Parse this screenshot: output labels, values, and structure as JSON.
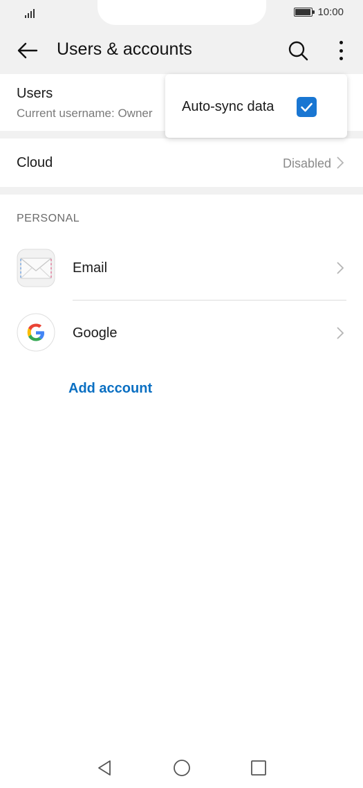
{
  "status_bar": {
    "time": "10:00"
  },
  "app_bar": {
    "title": "Users & accounts",
    "back_icon": "arrow-back-icon",
    "search_icon": "search-icon",
    "more_icon": "more-vert-icon"
  },
  "users": {
    "label": "Users",
    "subtitle": "Current username: Owner"
  },
  "cloud": {
    "label": "Cloud",
    "value": "Disabled"
  },
  "section": {
    "header": "PERSONAL"
  },
  "accounts": [
    {
      "name": "Email",
      "icon": "email-envelope-icon"
    },
    {
      "name": "Google",
      "icon": "google-g-icon"
    }
  ],
  "add_account_label": "Add account",
  "popup": {
    "auto_sync_label": "Auto-sync data",
    "auto_sync_checked": true
  },
  "colors": {
    "accent": "#1976d2",
    "link": "#0a6fc2",
    "band": "#f1f1f1"
  },
  "nav": {
    "back": "nav-back-icon",
    "home": "nav-home-icon",
    "recents": "nav-recents-icon"
  }
}
